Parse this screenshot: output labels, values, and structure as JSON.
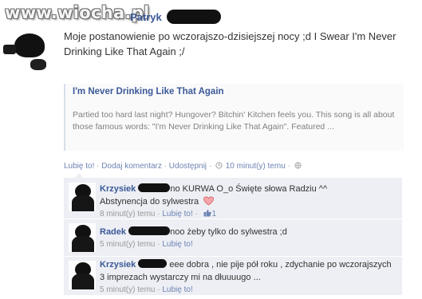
{
  "watermark": "www.wiocha.pl",
  "post": {
    "author_first": "Patryk",
    "text": "Moje postanowienie po wczorajszo-dzisiejszej nocy ;d I Swear I'm Never Drinking Like That Again ;/",
    "attachment": {
      "title": "I'm Never Drinking Like That Again",
      "description": "Partied too hard last night? Hungover? Bitchin' Kitchen feels you. This song is all about those famous words: \"I'm Never Drinking Like That Again\". Featured ..."
    },
    "actions": {
      "like": "Lubię to!",
      "comment": "Dodaj komentarz",
      "share": "Udostępnij",
      "time": "10 minut(y) temu",
      "separator": "·"
    }
  },
  "comments": [
    {
      "author": "Krzysiek",
      "text_a": "no KURWA O_o Święte słowa Radziu ^^",
      "text_b": "Abstynencja do sylwestra",
      "time": "8 minut(y) temu",
      "like": "Lubię to!",
      "likes_count": "1"
    },
    {
      "author": "Radek",
      "text_a": "noo żeby tylko do sylwestra ;d",
      "time": "5 minut(y) temu",
      "like": "Lubię to!"
    },
    {
      "author": "Krzysiek",
      "text_a": "eee dobra , nie pije pół roku , zdychanie po wczorajszych 3 imprezach wystarczy mi na dłuuuugo ...",
      "time": "5 minut(y) temu",
      "like": "Lubię to!"
    }
  ],
  "colors": {
    "link": "#3b5998",
    "muted_link": "#6d84b4",
    "comment_bg": "#edeff4",
    "heart": "#e8707a"
  }
}
